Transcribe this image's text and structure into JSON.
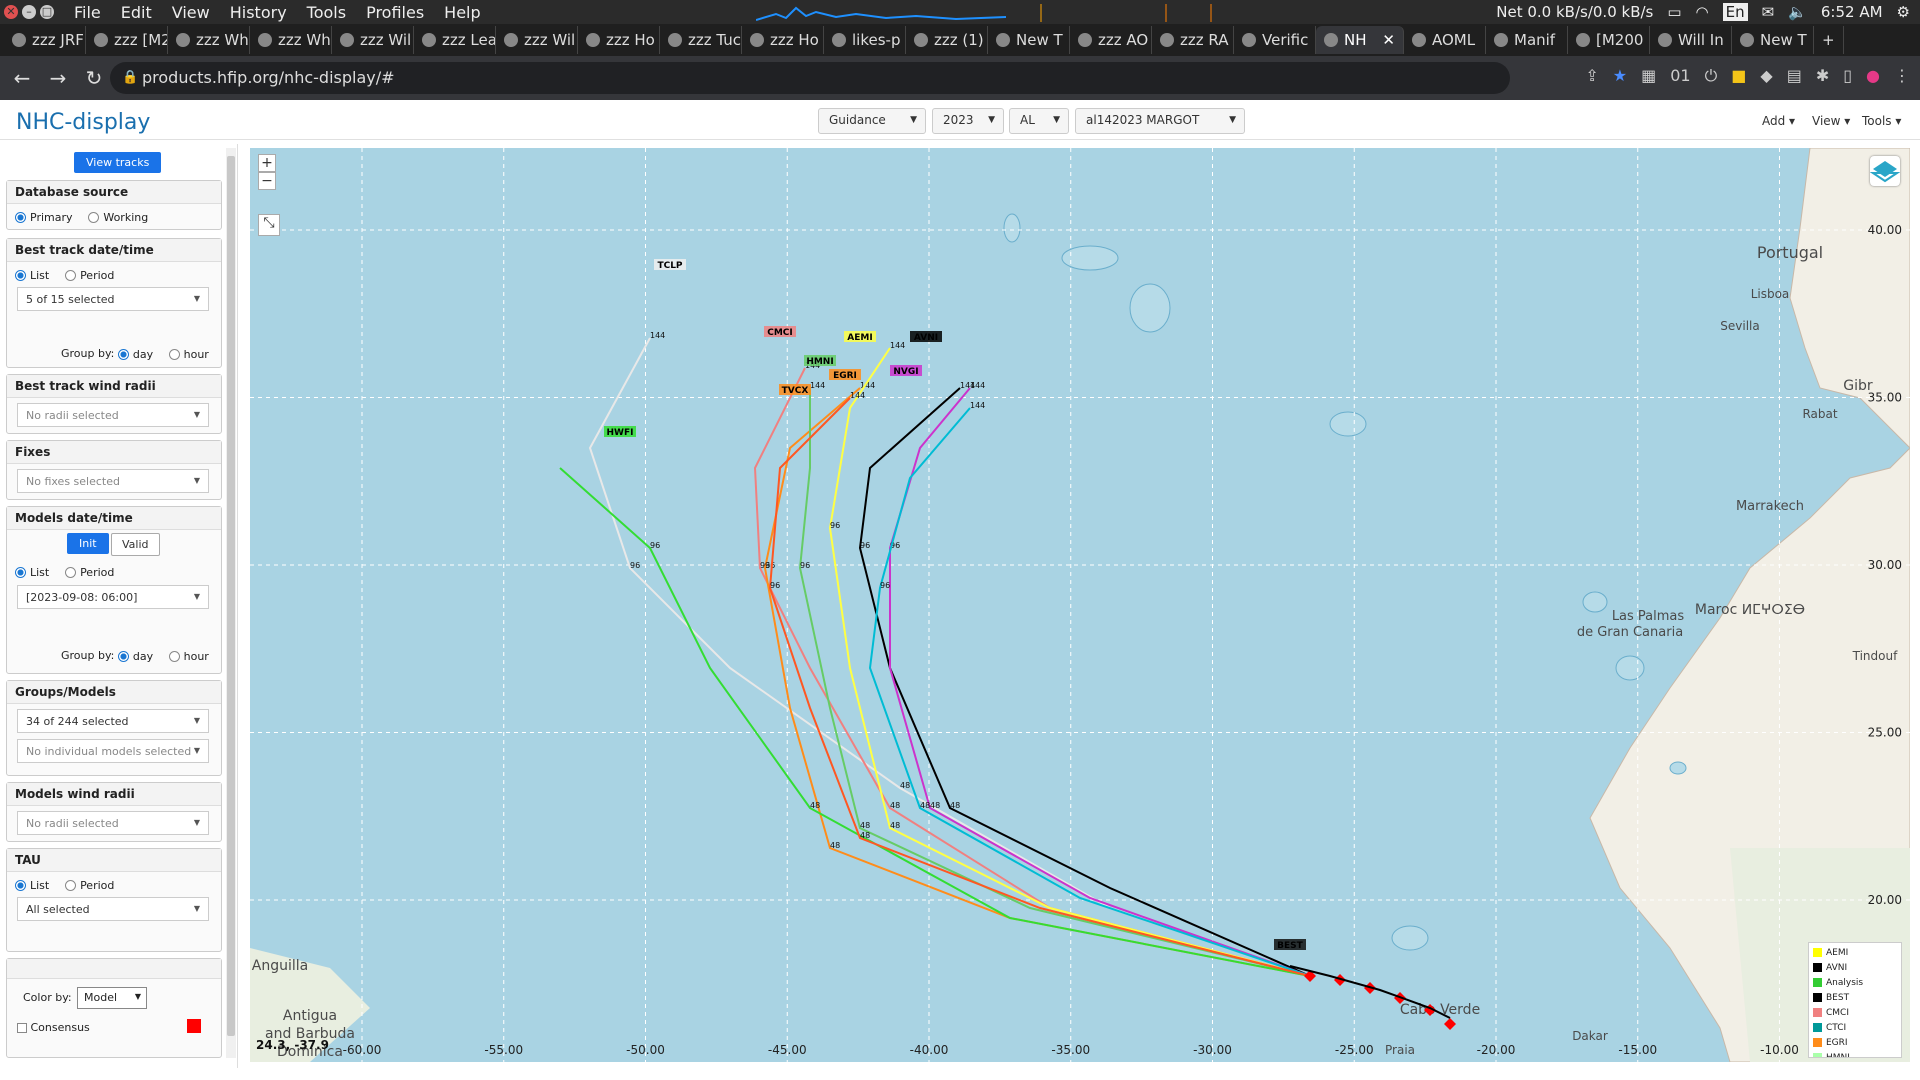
{
  "sysbar": {
    "menus": [
      "File",
      "Edit",
      "View",
      "History",
      "Tools",
      "Profiles",
      "Help"
    ],
    "net": "Net 0.0 kB/s/0.0 kB/s",
    "lang": "En",
    "time": "6:52 AM"
  },
  "tabs": [
    {
      "label": "zzz JRF"
    },
    {
      "label": "zzz [M2"
    },
    {
      "label": "zzz Wh"
    },
    {
      "label": "zzz Wh"
    },
    {
      "label": "zzz Wil"
    },
    {
      "label": "zzz Lea"
    },
    {
      "label": "zzz Wil"
    },
    {
      "label": "zzz Ho"
    },
    {
      "label": "zzz Tuc"
    },
    {
      "label": "zzz Ho"
    },
    {
      "label": "likes-p"
    },
    {
      "label": "zzz (1)"
    },
    {
      "label": "New T"
    },
    {
      "label": "zzz AO"
    },
    {
      "label": "zzz RA"
    },
    {
      "label": "Verific"
    },
    {
      "label": "NH",
      "active": true
    },
    {
      "label": "AOML"
    },
    {
      "label": "Manif"
    },
    {
      "label": "[M200"
    },
    {
      "label": "Will In"
    },
    {
      "label": "New T"
    }
  ],
  "address": {
    "url": "products.hfip.org/nhc-display/#"
  },
  "app": {
    "brand": "NHC-display",
    "selects": {
      "product": "Guidance",
      "year": "2023",
      "basin": "AL",
      "storm": "al142023 MARGOT"
    },
    "menus": {
      "add": "Add",
      "view": "View",
      "tools": "Tools"
    }
  },
  "sidebar": {
    "view_tracks": "View tracks",
    "db_source": {
      "title": "Database source",
      "primary": "Primary",
      "working": "Working"
    },
    "best_track": {
      "title": "Best track date/time",
      "list": "List",
      "period": "Period",
      "selected": "5 of 15 selected",
      "group_by": "Group by:",
      "day": "day",
      "hour": "hour"
    },
    "bt_wind": {
      "title": "Best track wind radii",
      "placeholder": "No radii selected"
    },
    "fixes": {
      "title": "Fixes",
      "placeholder": "No fixes selected"
    },
    "models_dt": {
      "title": "Models date/time",
      "init": "Init",
      "valid": "Valid",
      "list": "List",
      "period": "Period",
      "selected": "[2023-09-08: 06:00]",
      "group_by": "Group by:",
      "day": "day",
      "hour": "hour"
    },
    "groups": {
      "title": "Groups/Models",
      "selected": "34 of 244 selected",
      "placeholder": "No individual models selected"
    },
    "models_wind": {
      "title": "Models wind radii",
      "placeholder": "No radii selected"
    },
    "tau": {
      "title": "TAU",
      "list": "List",
      "period": "Period",
      "selected": "All selected"
    },
    "color_by": {
      "label": "Color by:",
      "value": "Model"
    },
    "consensus": "Consensus"
  },
  "map": {
    "coord": "24.3, -37.9",
    "lat_ticks": [
      "40.00",
      "35.00",
      "30.00",
      "25.00",
      "20.00"
    ],
    "lon_ticks": [
      "-60.00",
      "-55.00",
      "-50.00",
      "-45.00",
      "-40.00",
      "-35.00",
      "-30.00",
      "-25.00",
      "-20.00",
      "-15.00",
      "-10.00"
    ],
    "places": [
      {
        "name": "Portugal"
      },
      {
        "name": "Lisboa"
      },
      {
        "name": "Sevilla"
      },
      {
        "name": "Gibr"
      },
      {
        "name": "Rabat"
      },
      {
        "name": "Marrakech"
      },
      {
        "name": "Las Palmas"
      },
      {
        "name": "de Gran Canaria"
      },
      {
        "name": "Maroc ⵍⵎⵖⵔⵉⴱ"
      },
      {
        "name": "Tindouf"
      },
      {
        "name": "Cabo Verde"
      },
      {
        "name": "Dakar"
      },
      {
        "name": "Praia"
      },
      {
        "name": "Antigua"
      },
      {
        "name": "and Barbuda"
      },
      {
        "name": "Anguilla"
      },
      {
        "name": "Dominica"
      }
    ],
    "models": [
      {
        "name": "TCLP",
        "color": "#f0f0f0"
      },
      {
        "name": "CMCI",
        "color": "#f08080"
      },
      {
        "name": "HMNI",
        "color": "#66cc66"
      },
      {
        "name": "AEMI",
        "color": "#ffff44"
      },
      {
        "name": "AVNI",
        "color": "#000000"
      },
      {
        "name": "NVGI",
        "color": "#cc33cc"
      },
      {
        "name": "TVCX",
        "color": "#ff8c1a"
      },
      {
        "name": "EGRI",
        "color": "#ff8c1a"
      },
      {
        "name": "HWFI",
        "color": "#33dd33"
      },
      {
        "name": "BEST",
        "color": "#111111"
      }
    ],
    "legend": [
      {
        "name": "AEMI",
        "color": "#ffff00"
      },
      {
        "name": "AVNI",
        "color": "#000000"
      },
      {
        "name": "Analysis",
        "color": "#33cc33"
      },
      {
        "name": "BEST",
        "color": "#000000"
      },
      {
        "name": "CMCI",
        "color": "#f08080"
      },
      {
        "name": "CTCI",
        "color": "#009999"
      },
      {
        "name": "EGRI",
        "color": "#ff8c1a"
      },
      {
        "name": "HMNI",
        "color": "#aaffaa"
      }
    ]
  }
}
